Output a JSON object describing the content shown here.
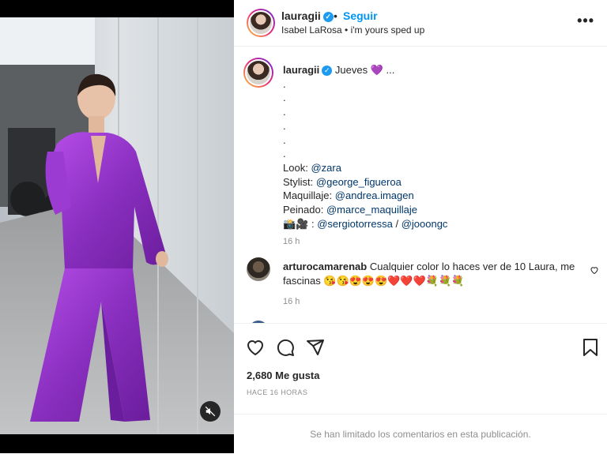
{
  "header": {
    "username": "lauragii",
    "separator": "•",
    "follow_label": "Seguir",
    "audio": "Isabel LaRosa • i'm yours sped up",
    "more": "•••"
  },
  "caption": {
    "username": "lauragii",
    "text": "Jueves 💜 ...",
    "dots": [
      ".",
      ".",
      ".",
      ".",
      ".",
      "."
    ],
    "look_label": "Look:",
    "look_mention": "@zara",
    "stylist_label": "Stylist:",
    "stylist_mention": "@george_figueroa",
    "makeup_label": "Maquillaje:",
    "makeup_mention": "@andrea.imagen",
    "hair_label": "Peinado:",
    "hair_mention": "@marce_maquillaje",
    "photo_label": "📸🎥 :",
    "photo_mention_1": "@sergiotorressa",
    "photo_sep": "/",
    "photo_mention_2": "@jooongc",
    "time": "16 h"
  },
  "comment": {
    "username": "arturocamarenab",
    "text": "Cualquier color lo haces ver de 10 Laura, me fascinas 😘😘😍😍😍❤️❤️❤️💐💐💐",
    "time": "16 h"
  },
  "stats": {
    "likes": "2,680 Me gusta",
    "ago": "HACE 16 HORAS"
  },
  "footer": {
    "limited": "Se han limitado los comentarios en esta publicación."
  },
  "icons": {
    "like": "heart-icon",
    "comment": "comment-icon",
    "share": "paper-plane-icon",
    "save": "bookmark-icon",
    "mute": "muted-speaker-icon"
  },
  "colors": {
    "accent": "#0095f6",
    "verified": "#1d9bf0",
    "suit": "#8a2fc0"
  }
}
